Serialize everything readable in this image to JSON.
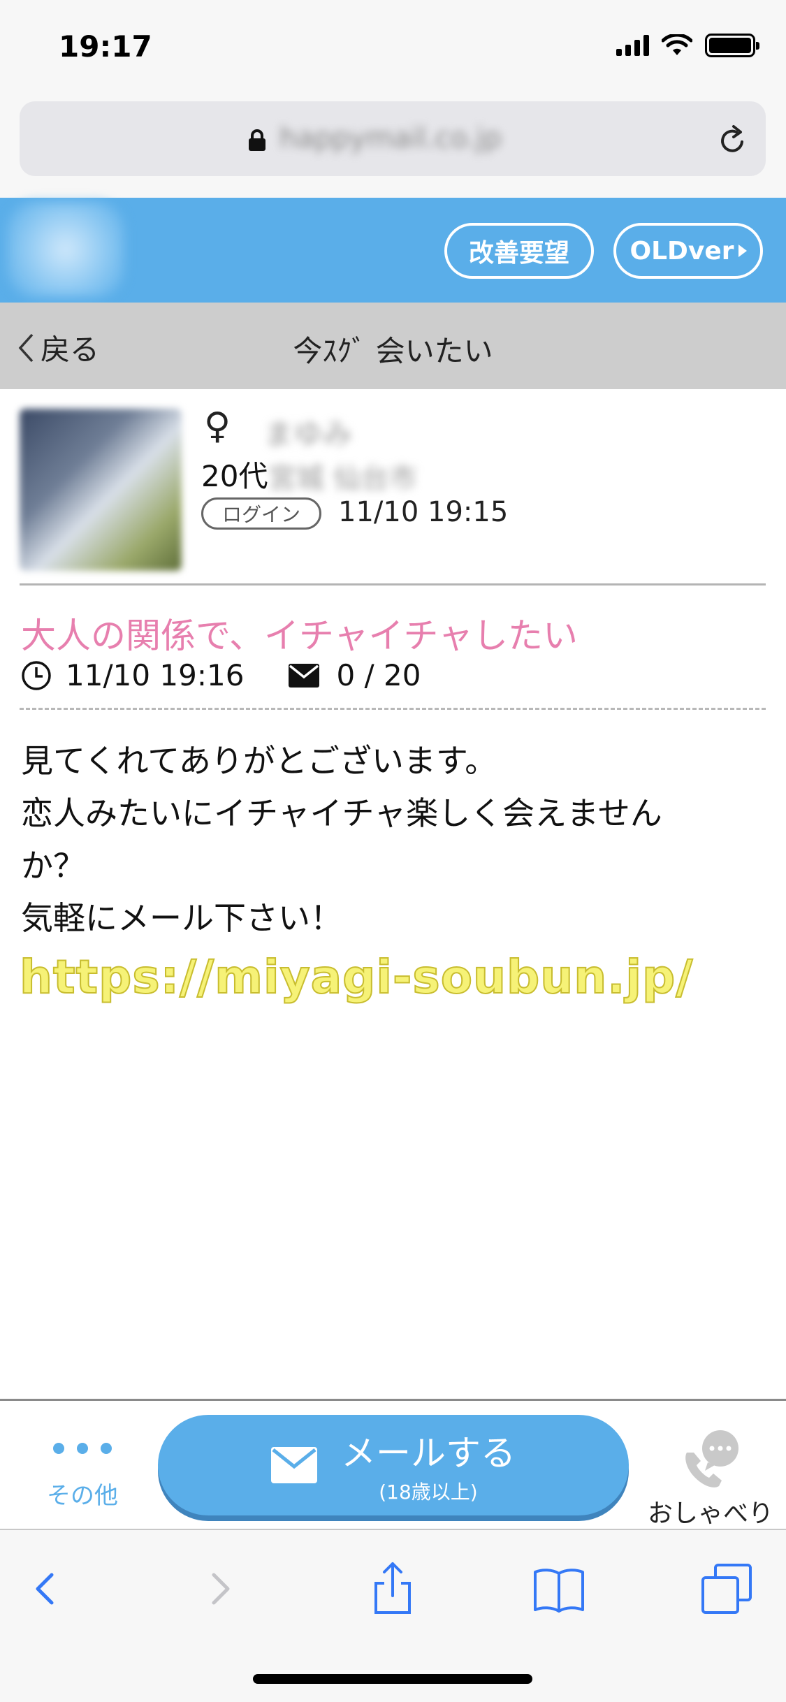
{
  "status_bar": {
    "time": "19:17"
  },
  "browser": {
    "url": "happymail.co.jp"
  },
  "header": {
    "request_button": "改善要望",
    "old_version_button": "OLDver"
  },
  "nav": {
    "back_label": "戻る",
    "page_title": "今ｽｸﾞ 会いたい"
  },
  "profile": {
    "gender_symbol": "♀",
    "nickname": "まゆみ",
    "age": "20代",
    "area": "宮城 仙台市",
    "login_badge": "ログイン",
    "login_time": "11/10 19:15"
  },
  "post": {
    "title": "大人の関係で、イチャイチャしたい",
    "posted_time": "11/10 19:16",
    "mail_count": "0 / 20",
    "body_lines": [
      "見てくれてありがとございます。",
      "恋人みたいにイチャイチャ楽しく会えません",
      "か？",
      "気軽にメール下さい！"
    ],
    "watermark": "https://miyagi-soubun.jp/"
  },
  "toolbar": {
    "more_label": "その他",
    "mail_button_main": "メールする",
    "mail_button_sub": "(18歳以上)",
    "chat_label": "おしゃべり"
  },
  "colors": {
    "accent_blue": "#5aaee9",
    "title_pink": "#e77fae",
    "watermark_yellow": "#f6f277"
  }
}
